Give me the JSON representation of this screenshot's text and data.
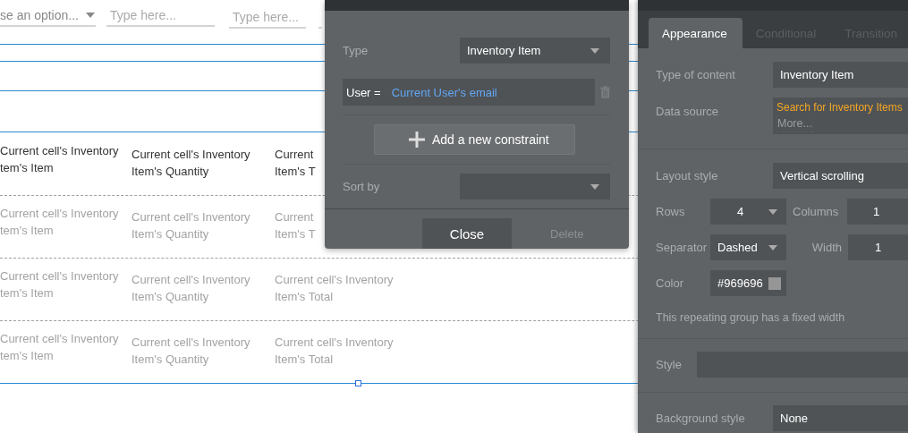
{
  "canvas": {
    "inputs": [
      {
        "kind": "dropdown",
        "value": "se an option..."
      },
      {
        "kind": "text",
        "placeholder": "Type here..."
      },
      {
        "kind": "text",
        "placeholder": "Type here..."
      },
      {
        "kind": "text"
      }
    ],
    "rows": [
      {
        "dimmed": false,
        "cells": [
          "Current cell's Inventory\ntem's Item",
          "Current cell's Inventory\nItem's Quantity",
          "Current\nItem's T"
        ]
      },
      {
        "dimmed": true,
        "cells": [
          "Current cell's Inventory\ntem's Item",
          "Current cell's Inventory\nItem's Quantity",
          "Current\nItem's T"
        ]
      },
      {
        "dimmed": true,
        "cells": [
          "Current cell's Inventory\ntem's Item",
          "Current cell's Inventory\nItem's Quantity",
          "Current cell's Inventory\nItem's Total"
        ]
      },
      {
        "dimmed": true,
        "cells": [
          "Current cell's Inventory\ntem's Item",
          "Current cell's Inventory\nItem's Quantity",
          "Current cell's Inventory\nItem's Total"
        ]
      }
    ]
  },
  "search_popup": {
    "type": {
      "label": "Type",
      "value": "Inventory Item"
    },
    "constraints": [
      {
        "field": "User =",
        "value": "Current User's email"
      }
    ],
    "add_button": "Add a new constraint",
    "sort": {
      "label": "Sort by"
    },
    "close_button": "Close",
    "delete_button": {
      "label": "Delete",
      "disabled": true
    }
  },
  "property_panel": {
    "tabs": [
      {
        "label": "Appearance",
        "selected": true
      },
      {
        "label": "Conditional",
        "selected": false
      },
      {
        "label": "Transition",
        "selected": false
      }
    ],
    "type_of_content": {
      "label": "Type of content",
      "value": "Inventory Item"
    },
    "data_source": {
      "label": "Data source",
      "value": "Search for Inventory Items",
      "more": "More..."
    },
    "layout_style": {
      "label": "Layout style",
      "value": "Vertical scrolling"
    },
    "rows": {
      "label": "Rows",
      "value": "4"
    },
    "columns": {
      "label": "Columns",
      "value": "1"
    },
    "separator": {
      "label": "Separator",
      "value": "Dashed"
    },
    "width": {
      "label": "Width",
      "value": "1"
    },
    "color": {
      "label": "Color",
      "value": "#969696"
    },
    "note": "This repeating group has a fixed width",
    "style": {
      "label": "Style"
    },
    "background_style": {
      "label": "Background style",
      "value": "None"
    }
  }
}
